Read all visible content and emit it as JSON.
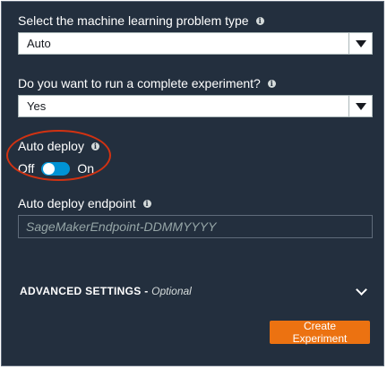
{
  "problem_type": {
    "label": "Select the machine learning problem type",
    "value": "Auto"
  },
  "complete_experiment": {
    "label": "Do you want to run a complete experiment?",
    "value": "Yes"
  },
  "auto_deploy": {
    "label": "Auto deploy",
    "off_label": "Off",
    "on_label": "On",
    "state": "on"
  },
  "endpoint": {
    "label": "Auto deploy endpoint",
    "placeholder": "SageMakerEndpoint-DDMMYYYY"
  },
  "advanced": {
    "title": "ADVANCED SETTINGS",
    "separator": " - ",
    "optional": "Optional"
  },
  "actions": {
    "create_label": "Create Experiment"
  },
  "info_glyph": "i",
  "colors": {
    "panel_bg": "#232f3e",
    "toggle_on": "#0093d5",
    "primary_button": "#ec7211",
    "highlight": "#d13212"
  }
}
